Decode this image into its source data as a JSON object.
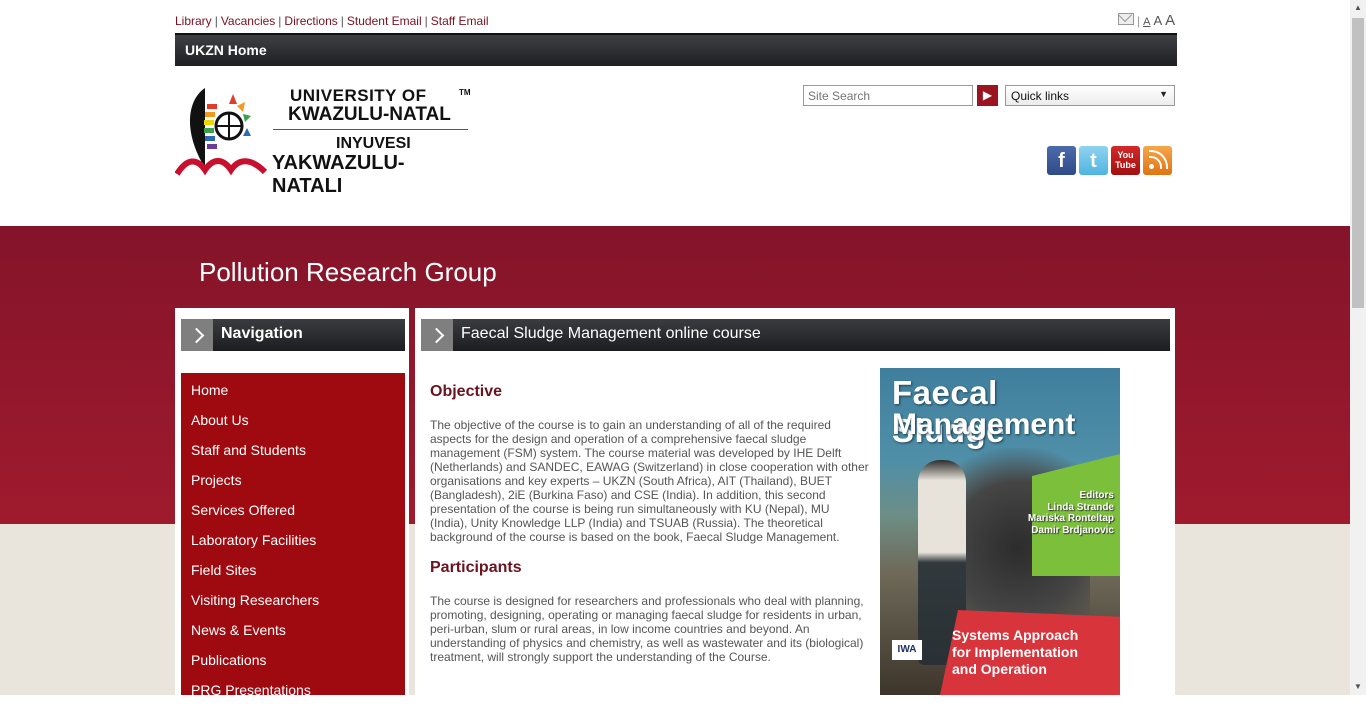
{
  "top_links": [
    "Library",
    "Vacancies",
    "Directions",
    "Student Email",
    "Staff Email"
  ],
  "accessibility": {
    "a_small": "A",
    "a_medium": "A",
    "a_large": "A"
  },
  "topbar": {
    "home": "UKZN Home"
  },
  "logo": {
    "line1": "UNIVERSITY OF",
    "line2": "KWAZULU-NATAL",
    "line3": "INYUVESI",
    "line4": "YAKWAZULU-NATALI",
    "tm": "TM"
  },
  "search": {
    "placeholder": "Site Search",
    "go_icon": "arrow-right-icon"
  },
  "quick_links": {
    "selected": "Quick links"
  },
  "social": {
    "facebook": "f",
    "twitter": "t",
    "youtube_line1": "You",
    "youtube_line2": "Tube"
  },
  "group_title": "Pollution Research Group",
  "nav": {
    "title": "Navigation",
    "items": [
      "Home",
      "About Us",
      "Staff and Students",
      "Projects",
      "Services Offered",
      "Laboratory Facilities",
      "Field Sites",
      "Visiting Researchers",
      "News & Events",
      "Publications",
      "PRG Presentations"
    ]
  },
  "main": {
    "title": "Faecal Sludge Management online course",
    "objective_heading": "Objective",
    "objective_text": "The objective of the course is to gain an understanding of all of the required aspects for the design and operation of a comprehensive faecal sludge management (FSM) system. The course material was developed by IHE Delft (Netherlands) and SANDEC, EAWAG (Switzerland) in close cooperation with other organisations and key experts – UKZN (South Africa), AIT (Thailand), BUET (Bangladesh), 2iE (Burkina Faso) and CSE (India). In addition, this second presentation of the course is being run simultaneously with KU (Nepal), MU (India), Unity Knowledge LLP (India) and TSUAB (Russia). The theoretical background of the course is based on the book, Faecal Sludge Management.",
    "participants_heading": "Participants",
    "participants_text": "The course is designed for researchers and professionals who deal with planning, promoting, designing, operating or managing faecal sludge for residents in urban, peri-urban, slum or rural areas, in low income countries and beyond. An understanding of physics and chemistry, as well as wastewater and its (biological) treatment, will strongly support the understanding of the Course."
  },
  "book": {
    "title1": "Faecal Sludge",
    "title2": "Management",
    "editors_label": "Editors",
    "editors": [
      "Linda Strande",
      "Mariska Ronteltap",
      "Damir Brdjanovic"
    ],
    "subtitle1": "Systems Approach",
    "subtitle2": "for Implementation",
    "subtitle3": "and Operation",
    "publisher": "IWA"
  },
  "colors": {
    "brand_red": "#9e0a0f",
    "band_red": "#84142a",
    "heading_red": "#6b1320"
  }
}
